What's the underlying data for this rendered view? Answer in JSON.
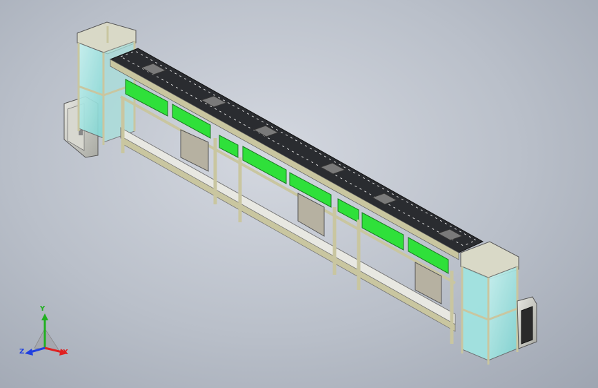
{
  "viewport": {
    "axes": {
      "x": "X",
      "y": "Y",
      "z": "Z"
    },
    "colors": {
      "background": "#b9bfc9",
      "frame": "#c9c6a0",
      "panel_green": "#2fe03a",
      "cabinet_glass": "#9fe8e4",
      "conveyor_top": "#222428",
      "axis_x": "#e02020",
      "axis_y": "#20b020",
      "axis_z": "#2040e0"
    }
  }
}
